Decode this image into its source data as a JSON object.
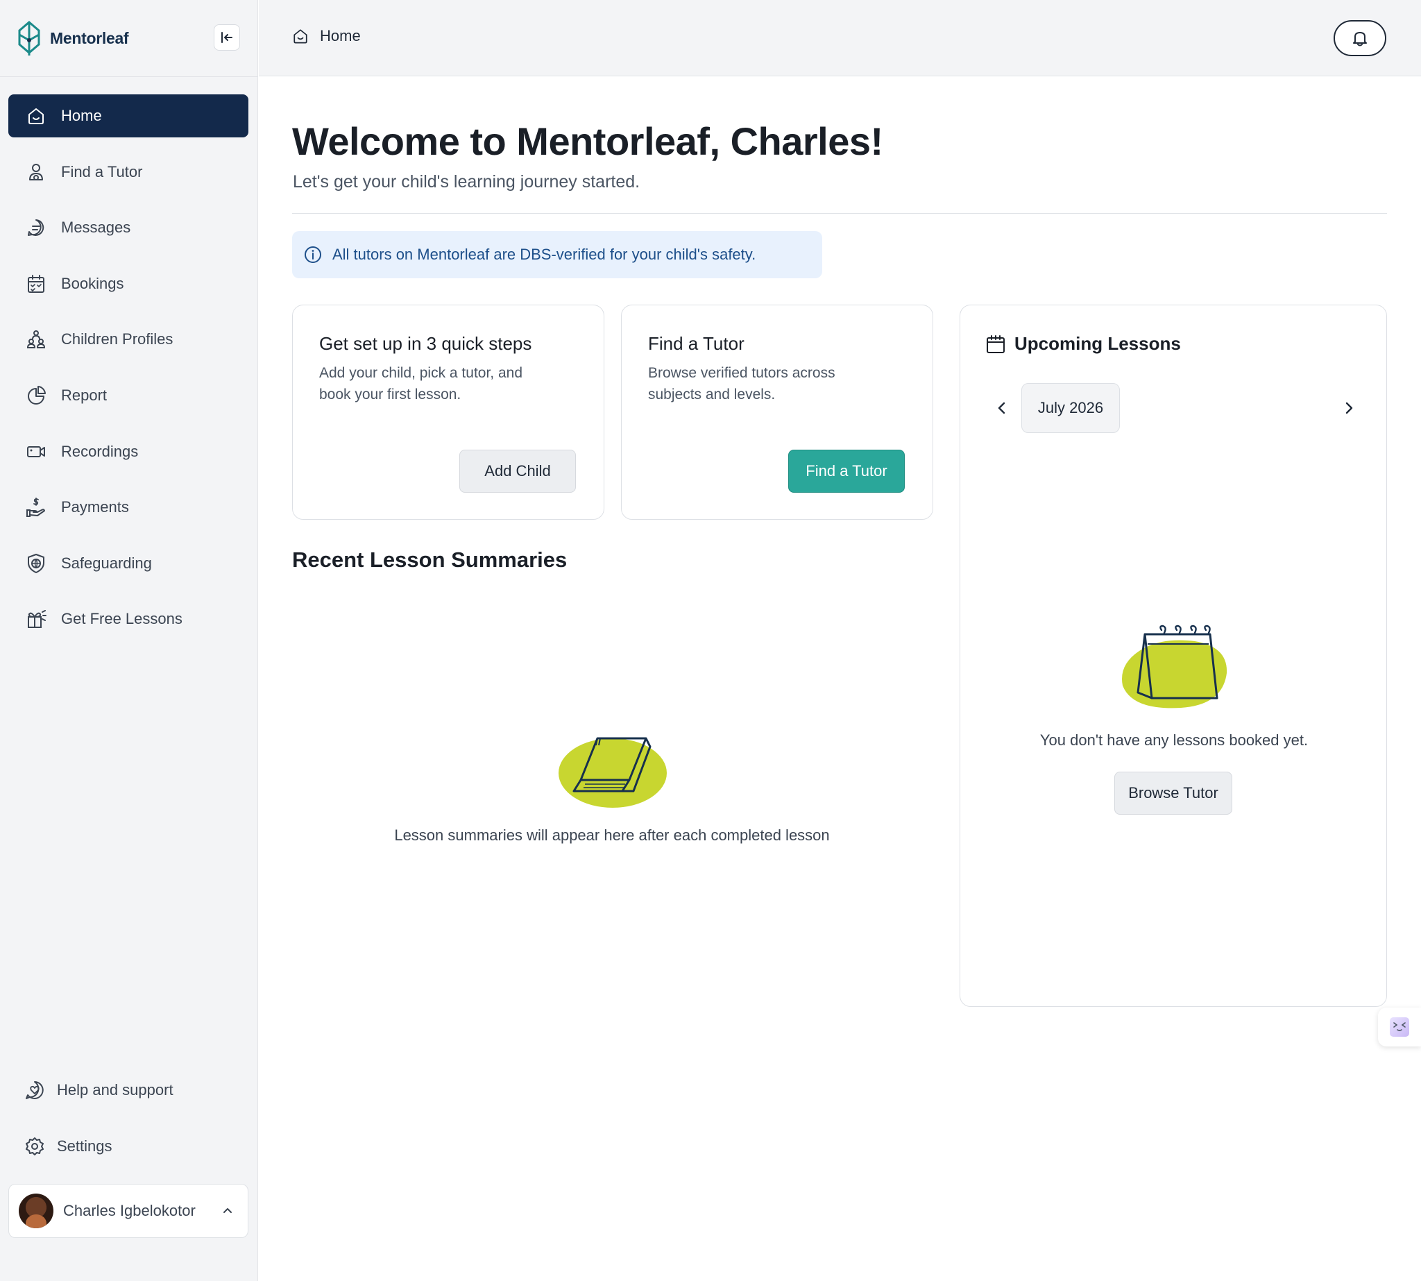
{
  "app": {
    "name": "Mentorleaf"
  },
  "sidebar": {
    "items": [
      {
        "label": "Home",
        "icon": "home-icon",
        "active": true
      },
      {
        "label": "Find a Tutor",
        "icon": "tutor-icon"
      },
      {
        "label": "Messages",
        "icon": "message-icon"
      },
      {
        "label": "Bookings",
        "icon": "calendar-check-icon"
      },
      {
        "label": "Children Profiles",
        "icon": "children-icon"
      },
      {
        "label": "Report",
        "icon": "pie-chart-icon"
      },
      {
        "label": "Recordings",
        "icon": "video-icon"
      },
      {
        "label": "Payments",
        "icon": "payment-hand-icon"
      },
      {
        "label": "Safeguarding",
        "icon": "shield-icon"
      },
      {
        "label": "Get Free Lessons",
        "icon": "gift-icon"
      }
    ],
    "bottom": {
      "help": "Help and support",
      "settings": "Settings"
    },
    "user": {
      "name": "Charles Igbelokotor"
    }
  },
  "topbar": {
    "breadcrumb": "Home"
  },
  "main": {
    "welcome": "Welcome to Mentorleaf, Charles!",
    "subtitle": "Let's get your child's learning journey started.",
    "info_banner": "All tutors on Mentorleaf are DBS-verified for your child's safety.",
    "setup_card": {
      "title": "Get set up in 3 quick steps",
      "description": "Add your child, pick a tutor, and book your first lesson.",
      "button": "Add Child"
    },
    "tutor_card": {
      "title": "Find a Tutor",
      "description": "Browse verified tutors across subjects and levels.",
      "button": "Find a Tutor"
    },
    "recent_summaries": {
      "title": "Recent Lesson Summaries",
      "empty_text": "Lesson summaries will appear here after each completed lesson"
    },
    "upcoming": {
      "title": "Upcoming Lessons",
      "month": "July 2026",
      "empty_text": "You don't have any lessons booked yet.",
      "button": "Browse Tutor"
    }
  },
  "colors": {
    "nav_active": "#13294b",
    "accent_teal": "#2aa79a",
    "illustration_lime": "#c8d630",
    "banner_bg": "#e8f1fd"
  }
}
